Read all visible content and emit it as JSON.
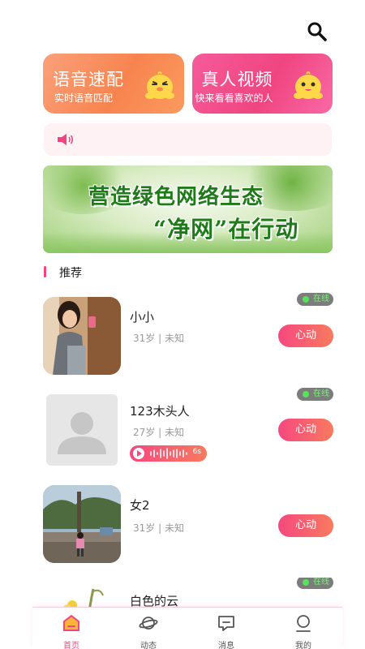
{
  "header": {
    "search_icon": "search-icon"
  },
  "quick_cards": [
    {
      "title": "语音速配",
      "subtitle": "实时语音匹配",
      "icon": "chick-mascot-icon",
      "color": "#f7844f"
    },
    {
      "title": "真人视频",
      "subtitle": "快来看看喜欢的人",
      "icon": "chick-mascot-icon",
      "color": "#f04580"
    }
  ],
  "notice": {
    "icon": "speaker-icon",
    "text": ""
  },
  "banner": {
    "line1": "营造绿色网络生态",
    "line2": "“净网”在行动"
  },
  "section": {
    "title": "推荐"
  },
  "users": [
    {
      "name": "小小",
      "meta": "31岁 | 未知",
      "status": "在线",
      "action": "心动",
      "avatar": "photo-girl-mirror"
    },
    {
      "name": "123木头人",
      "meta": "27岁 | 未知",
      "status": "在线",
      "action": "心动",
      "avatar": "default-person-icon",
      "voice_duration": "6s"
    },
    {
      "name": "女2",
      "meta": "31岁 | 未知",
      "status": "",
      "action": "心动",
      "avatar": "photo-park"
    },
    {
      "name": "白色的云",
      "meta": "",
      "status": "在线",
      "action": "",
      "avatar": "photo-plant"
    }
  ],
  "tabbar": {
    "tabs": [
      {
        "label": "首页",
        "icon": "home-icon",
        "active": true
      },
      {
        "label": "动态",
        "icon": "planet-icon",
        "active": false
      },
      {
        "label": "消息",
        "icon": "message-icon",
        "active": false
      },
      {
        "label": "我的",
        "icon": "profile-icon",
        "active": false
      }
    ],
    "active_color": "#f04580"
  }
}
